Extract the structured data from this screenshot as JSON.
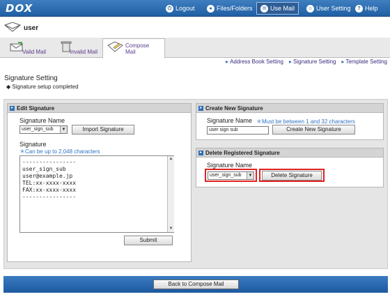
{
  "nav": {
    "logo": "DOX",
    "logout": "Logout",
    "files": "Files/Folders",
    "usemail": "Use Mail",
    "usersetting": "User Setting",
    "help": "Help"
  },
  "user": {
    "name": "user"
  },
  "tabs": [
    {
      "label": "Valid Mail"
    },
    {
      "label": "Invalid Mail"
    },
    {
      "label": "Compose Mail"
    }
  ],
  "links": {
    "address": "Address Book Setting",
    "signature": "Signature Setting",
    "template": "Template Setting"
  },
  "page": {
    "title": "Signature Setting",
    "status": "Signature setup completed"
  },
  "edit": {
    "heading": "Edit Signature",
    "name_label": "Signature Name",
    "selected": "user_sign_sub",
    "import_btn": "Import Signature",
    "sig_label": "Signature",
    "sig_note": "＊Can be up to 2,048 characters",
    "sig_text": "----------------\nuser_sign_sub\nuser@example.jp\nTEL:xx-xxxx-xxxx\nFAX:xx-xxxx-xxxx\n----------------",
    "submit": "Submit"
  },
  "create": {
    "heading": "Create New Signature",
    "name_label": "Signature Name",
    "note": "＊Must be between 1 and 32 characters",
    "value": "user sign sub",
    "btn": "Create New Signature"
  },
  "delete": {
    "heading": "Delete Registered Signature",
    "name_label": "Signature Name",
    "selected": "user_sign_sub",
    "btn": "Delete Signature"
  },
  "footer": {
    "back": "Back to Compose Mail"
  },
  "colors": {
    "nav": "#2465a8",
    "highlight": "#e02020",
    "accent_note": "#2f72c4"
  }
}
